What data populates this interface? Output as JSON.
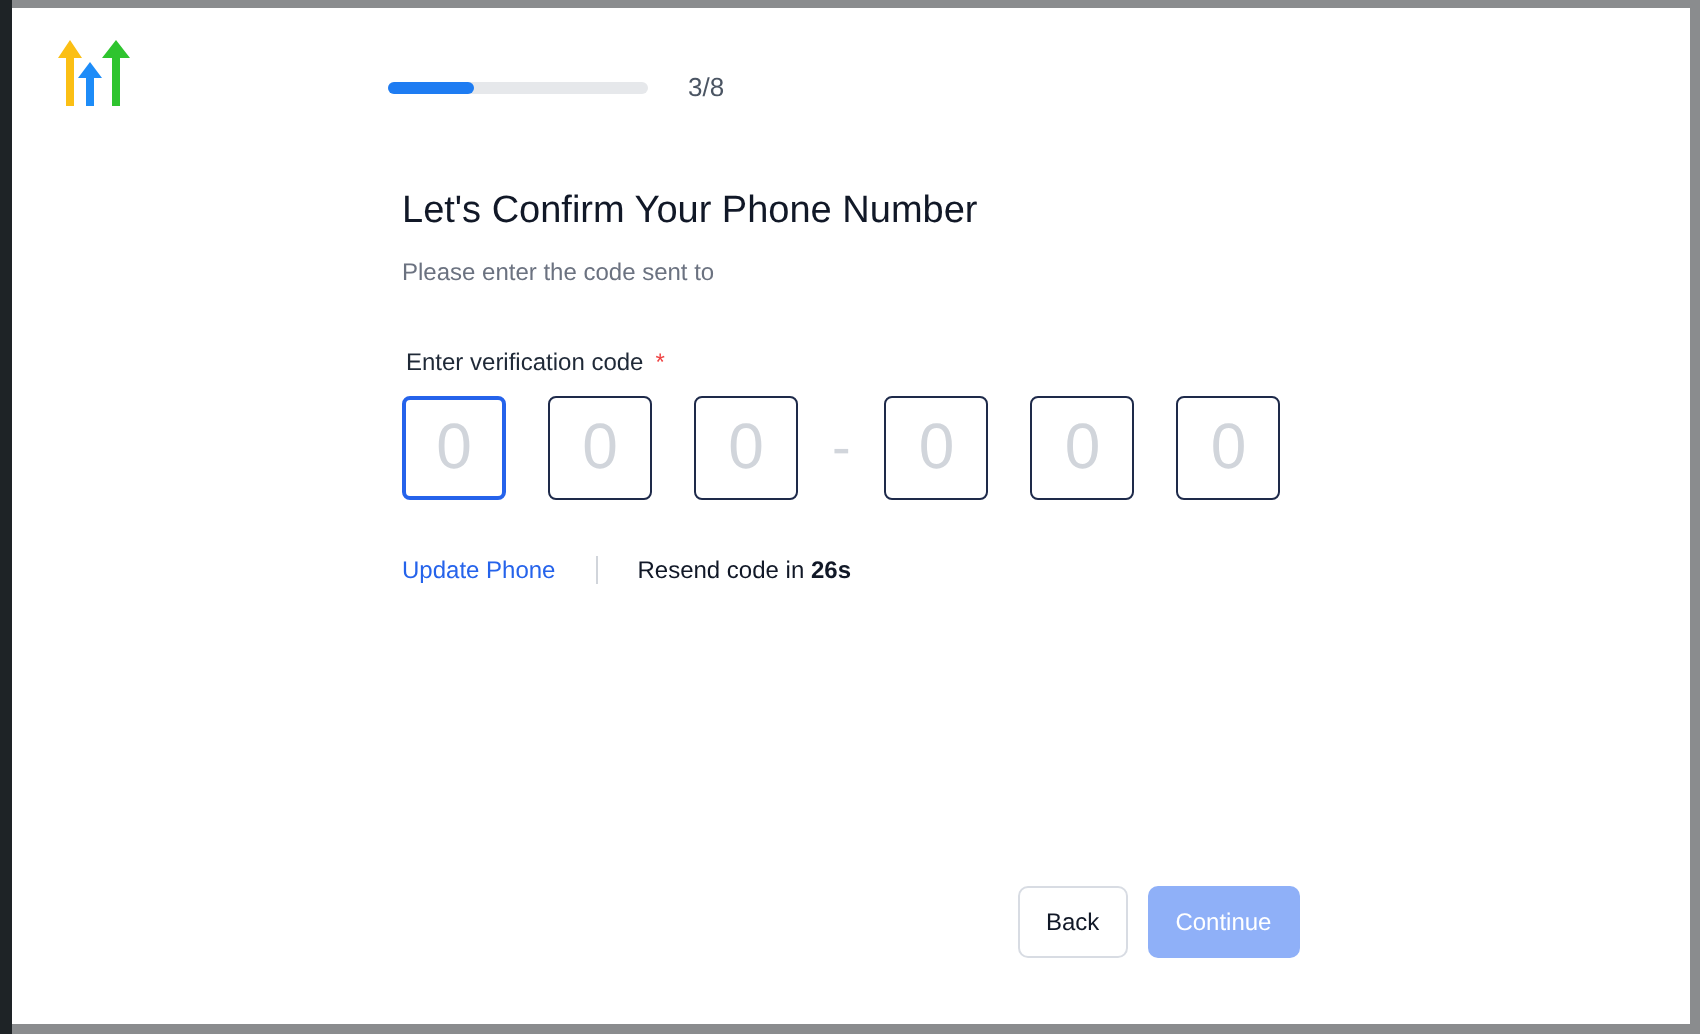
{
  "progress": {
    "level": 0.33,
    "label": "3/8"
  },
  "title": "Let's Confirm Your Phone Number",
  "subtitle": "Please enter the code sent to",
  "code_field": {
    "label": "Enter verification code",
    "required_mark": "*",
    "separator": "-",
    "digits": [
      {
        "placeholder": "0",
        "focused": true
      },
      {
        "placeholder": "0",
        "focused": false
      },
      {
        "placeholder": "0",
        "focused": false
      },
      {
        "placeholder": "0",
        "focused": false
      },
      {
        "placeholder": "0",
        "focused": false
      },
      {
        "placeholder": "0",
        "focused": false
      }
    ]
  },
  "update_link": "Update Phone",
  "resend_text": "Resend code in **26s**",
  "buttons": [
    {
      "label": "Back",
      "kind": "secondary",
      "disabled": false
    },
    {
      "label": "Continue",
      "kind": "primary",
      "disabled": true
    }
  ]
}
